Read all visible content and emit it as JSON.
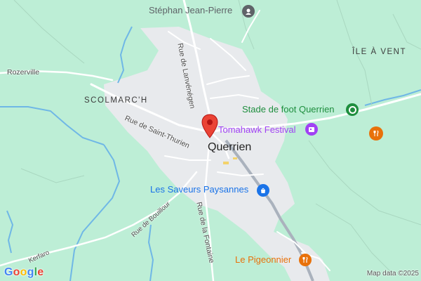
{
  "map": {
    "places": {
      "scolmarch": "SCOLMARC'H",
      "ile_a_vent": "ÎLE À VENT",
      "town": "Querrien"
    },
    "roads": {
      "rozerville": "Rozerville",
      "lanvenegen": "Rue de Lanvénégen",
      "saint_thurien": "Rue de Saint-Thurien",
      "bouillour": "Rue de Bouillour",
      "fontaine": "Rue de la Fontaine",
      "kerfaro": "Kerfaro"
    },
    "pois": {
      "stephan": {
        "name": "Stéphan Jean-Pierre",
        "icon": "pin-icon",
        "color": "#5f6368"
      },
      "stade": {
        "name": "Stade de foot Querrien",
        "icon": "park-icon",
        "color": "#1e8e3e"
      },
      "tomahawk": {
        "name": "Tomahawk Festival",
        "icon": "event-icon",
        "color": "#a142f4"
      },
      "saveurs": {
        "name": "Les Saveurs Paysannes",
        "icon": "shop-icon",
        "color": "#1a73e8"
      },
      "pigeonnier": {
        "name": "Le Pigeonnier",
        "icon": "restaurant-icon",
        "color": "#e8710a"
      },
      "restaurant_east": {
        "icon": "restaurant-icon",
        "color": "#e8710a"
      }
    },
    "marker": {
      "icon": "location-marker-icon",
      "color": "#ea4335"
    },
    "colors": {
      "land": "#bdeed6",
      "urban": "#e8eaed",
      "water": "#6fb7e6",
      "road": "#ffffff",
      "highway": "#aab2bd"
    }
  },
  "footer": {
    "logo": "Google",
    "attribution": "Map data ©2025"
  }
}
